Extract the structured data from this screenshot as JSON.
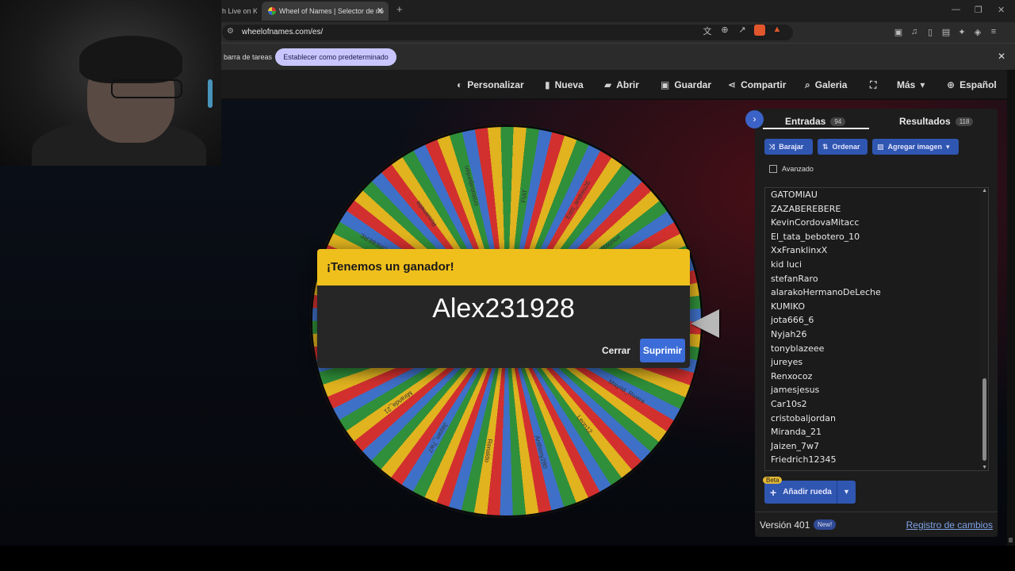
{
  "browser": {
    "inactive_tab_title": "h Live on K",
    "active_tab_title": "Wheel of Names | Selector de no",
    "new_tab_icon": "+",
    "url": "wheelofnames.com/es/",
    "infobar_text": "barra de tareas",
    "infobar_button": "Establecer como predeterminado"
  },
  "header": {
    "nav": [
      {
        "label": "Personalizar",
        "icon": "palette-icon"
      },
      {
        "label": "Nueva",
        "icon": "file-icon"
      },
      {
        "label": "Abrir",
        "icon": "folder-icon"
      },
      {
        "label": "Guardar",
        "icon": "save-icon"
      },
      {
        "label": "Compartir",
        "icon": "share-icon"
      },
      {
        "label": "Galeria",
        "icon": "search-icon"
      },
      {
        "label": "",
        "icon": "fullscreen-icon"
      },
      {
        "label": "Más",
        "icon": "chevron-down-icon"
      },
      {
        "label": "Español",
        "icon": "globe-icon"
      }
    ]
  },
  "dialog": {
    "title": "¡Tenemos un ganador!",
    "winner": "Alex231928",
    "close_label": "Cerrar",
    "remove_label": "Suprimir"
  },
  "panel": {
    "tabs": [
      {
        "label": "Entradas",
        "count": "94"
      },
      {
        "label": "Resultados",
        "count": "118"
      }
    ],
    "shuffle_label": "Barajar",
    "sort_label": "Ordenar",
    "add_image_label": "Agregar imagen",
    "advanced_label": "Avanzado",
    "entries": [
      "GATOMIAU",
      "ZAZABEREBERE",
      "KevinCordovaMitacc",
      "El_tata_bebotero_10",
      "XxFranklinxX",
      "kid luci",
      "stefanRaro",
      "alarakoHermanoDeLeche",
      "KUMIKO",
      "jota666_6",
      "Nyjah26",
      "tonyblazeee",
      "jureyes",
      "Renxocoz",
      "jamesjesus",
      "Car10s2",
      "cristobaljordan",
      "Miranda_21",
      "Jaizen_7w7",
      "Friedrich12345"
    ],
    "beta_label": "Beta",
    "add_wheel_label": "Añadir rueda",
    "version": "Versión 401",
    "new_badge": "New!",
    "changelog": "Registro de cambios"
  },
  "wheel_labels": [
    "FIAT",
    "Esto_andreu26",
    "Roonoe",
    "Edu",
    "Dibbi",
    "Mayrid_Rivera",
    "Leon12",
    "Anthony280",
    "Renaldo",
    "Jaizen_7w7",
    "Miranda_21",
    "Car10s2",
    "Friedrich12345",
    "ZAZABEREBERE",
    "Rosamelia",
    "cristobaljordan"
  ],
  "colors": {
    "yellow": "#e0b31f",
    "green": "#2f8f3a",
    "blue": "#3f70c8",
    "red": "#d2302f",
    "accent": "#3b6cd8",
    "dialog_header": "#efbf1c"
  }
}
